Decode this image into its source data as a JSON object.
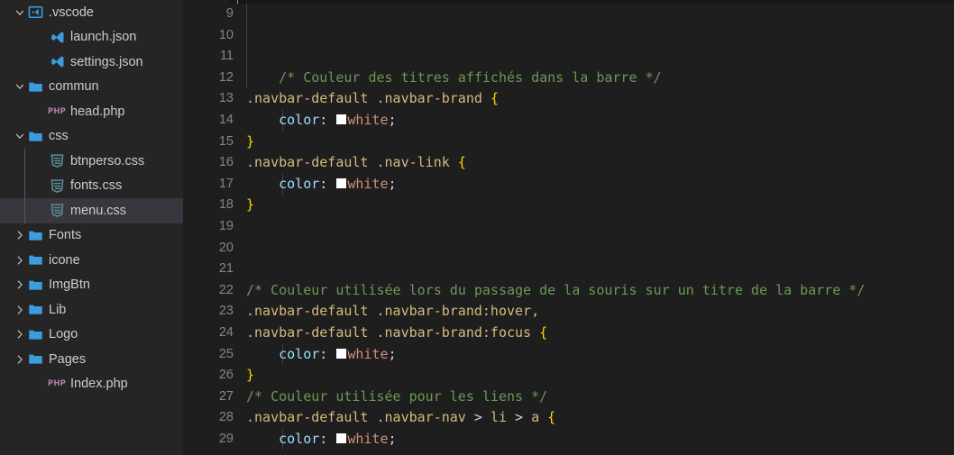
{
  "sidebar": {
    "items": [
      {
        "label": ".vscode",
        "icon": "vscode-folder-icon",
        "indent": 0,
        "twisty": "down",
        "selected": false
      },
      {
        "label": "launch.json",
        "icon": "vscode-file-icon",
        "indent": 1,
        "twisty": "none",
        "selected": false
      },
      {
        "label": "settings.json",
        "icon": "vscode-file-icon",
        "indent": 1,
        "twisty": "none",
        "selected": false
      },
      {
        "label": "commun",
        "icon": "folder-icon",
        "indent": 0,
        "twisty": "down",
        "selected": false
      },
      {
        "label": "head.php",
        "icon": "php-file-icon",
        "indent": 1,
        "twisty": "none",
        "selected": false
      },
      {
        "label": "css",
        "icon": "folder-icon",
        "indent": 0,
        "twisty": "down",
        "selected": false
      },
      {
        "label": "btnperso.css",
        "icon": "css-file-icon",
        "indent": 1,
        "twisty": "none",
        "selected": false
      },
      {
        "label": "fonts.css",
        "icon": "css-file-icon",
        "indent": 1,
        "twisty": "none",
        "selected": false
      },
      {
        "label": "menu.css",
        "icon": "css-file-icon",
        "indent": 1,
        "twisty": "none",
        "selected": true
      },
      {
        "label": "Fonts",
        "icon": "folder-icon",
        "indent": 0,
        "twisty": "right",
        "selected": false
      },
      {
        "label": "icone",
        "icon": "folder-icon",
        "indent": 0,
        "twisty": "right",
        "selected": false
      },
      {
        "label": "ImgBtn",
        "icon": "folder-icon",
        "indent": 0,
        "twisty": "right",
        "selected": false
      },
      {
        "label": "Lib",
        "icon": "folder-icon",
        "indent": 0,
        "twisty": "right",
        "selected": false
      },
      {
        "label": "Logo",
        "icon": "folder-icon",
        "indent": 0,
        "twisty": "right",
        "selected": false
      },
      {
        "label": "Pages",
        "icon": "folder-icon",
        "indent": 0,
        "twisty": "right",
        "selected": false
      },
      {
        "label": "Index.php",
        "icon": "php-file-icon",
        "indent": 1,
        "twisty": "none",
        "selected": false
      }
    ],
    "php_icon_text": "PHP"
  },
  "editor": {
    "language": "css",
    "first_visible_line": 9,
    "lines": [
      {
        "num": 9,
        "indent_guides": [
          0
        ],
        "tokens": []
      },
      {
        "num": 10,
        "indent_guides": [
          0
        ],
        "tokens": []
      },
      {
        "num": 11,
        "indent_guides": [
          0
        ],
        "tokens": []
      },
      {
        "num": 12,
        "indent_guides": [
          0
        ],
        "tokens": [
          {
            "t": "comment",
            "v": "    /* Couleur des titres affichés dans la barre */"
          }
        ]
      },
      {
        "num": 13,
        "indent_guides": [],
        "tokens": [
          {
            "t": "sel",
            "v": ".navbar-default .navbar-brand "
          },
          {
            "t": "brace",
            "v": "{"
          }
        ]
      },
      {
        "num": 14,
        "indent_guides": [
          1
        ],
        "tokens": [
          {
            "t": "prop",
            "v": "    color"
          },
          {
            "t": "plain",
            "v": ": "
          },
          {
            "t": "swatch",
            "v": "#ffffff"
          },
          {
            "t": "val",
            "v": "white"
          },
          {
            "t": "plain",
            "v": ";"
          }
        ]
      },
      {
        "num": 15,
        "indent_guides": [],
        "tokens": [
          {
            "t": "brace",
            "v": "}"
          }
        ]
      },
      {
        "num": 16,
        "indent_guides": [],
        "tokens": [
          {
            "t": "sel",
            "v": ".navbar-default .nav-link "
          },
          {
            "t": "brace",
            "v": "{"
          }
        ]
      },
      {
        "num": 17,
        "indent_guides": [
          1
        ],
        "tokens": [
          {
            "t": "prop",
            "v": "    color"
          },
          {
            "t": "plain",
            "v": ": "
          },
          {
            "t": "swatch",
            "v": "#ffffff"
          },
          {
            "t": "val",
            "v": "white"
          },
          {
            "t": "plain",
            "v": ";"
          }
        ]
      },
      {
        "num": 18,
        "indent_guides": [],
        "tokens": [
          {
            "t": "brace",
            "v": "}"
          }
        ]
      },
      {
        "num": 19,
        "indent_guides": [],
        "tokens": []
      },
      {
        "num": 20,
        "indent_guides": [],
        "tokens": []
      },
      {
        "num": 21,
        "indent_guides": [],
        "tokens": []
      },
      {
        "num": 22,
        "indent_guides": [],
        "tokens": [
          {
            "t": "comment",
            "v": "/* Couleur utilisée lors du passage de la souris sur un titre de la barre */"
          }
        ]
      },
      {
        "num": 23,
        "indent_guides": [],
        "tokens": [
          {
            "t": "sel",
            "v": ".navbar-default .navbar-brand:hover,"
          }
        ]
      },
      {
        "num": 24,
        "indent_guides": [],
        "tokens": [
          {
            "t": "sel",
            "v": ".navbar-default .navbar-brand:focus "
          },
          {
            "t": "brace",
            "v": "{"
          }
        ]
      },
      {
        "num": 25,
        "indent_guides": [
          1
        ],
        "tokens": [
          {
            "t": "prop",
            "v": "    color"
          },
          {
            "t": "plain",
            "v": ": "
          },
          {
            "t": "swatch",
            "v": "#ffffff"
          },
          {
            "t": "val",
            "v": "white"
          },
          {
            "t": "plain",
            "v": ";"
          }
        ]
      },
      {
        "num": 26,
        "indent_guides": [],
        "tokens": [
          {
            "t": "brace",
            "v": "}"
          }
        ]
      },
      {
        "num": 27,
        "indent_guides": [],
        "tokens": [
          {
            "t": "comment",
            "v": "/* Couleur utilisée pour les liens */"
          }
        ]
      },
      {
        "num": 28,
        "indent_guides": [],
        "tokens": [
          {
            "t": "sel",
            "v": ".navbar-default .navbar-nav "
          },
          {
            "t": "comb",
            "v": "> "
          },
          {
            "t": "tag",
            "v": "li "
          },
          {
            "t": "comb",
            "v": "> "
          },
          {
            "t": "tag",
            "v": "a "
          },
          {
            "t": "brace",
            "v": "{"
          }
        ]
      },
      {
        "num": 29,
        "indent_guides": [
          1
        ],
        "tokens": [
          {
            "t": "prop",
            "v": "    color"
          },
          {
            "t": "plain",
            "v": ": "
          },
          {
            "t": "swatch",
            "v": "#ffffff"
          },
          {
            "t": "val",
            "v": "white"
          },
          {
            "t": "plain",
            "v": ";"
          }
        ]
      }
    ]
  },
  "colors": {
    "editor_background": "#1e1e1e",
    "sidebar_background": "#252526",
    "selection_background": "#37373d",
    "line_number": "#858585",
    "comment": "#6a9955",
    "selector": "#d7ba7d",
    "property": "#9cdcfe",
    "value": "#ce9178",
    "brace": "#ffd700",
    "folder_blue": "#3b9ddd",
    "php_pink": "#b180a5",
    "css_teal": "#5c8c96"
  }
}
